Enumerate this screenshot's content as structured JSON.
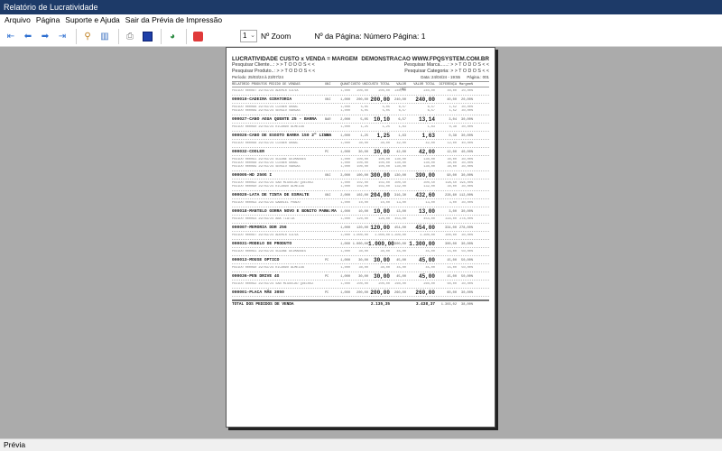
{
  "window": {
    "title": "Relatório de Lucratividade"
  },
  "menu": [
    "Arquivo",
    "Página",
    "Suporte e Ajuda",
    "Sair da Prévia de Impressão"
  ],
  "toolbar": {
    "page_select": "1",
    "zoom_label": "Nº Zoom",
    "page_info": "Nº da Página: Número Página: 1",
    "icons": [
      "first-page-icon",
      "previous-page-icon",
      "next-page-icon",
      "last-page-icon",
      "zoom-icon",
      "page-view-icon",
      "print-icon",
      "export-icon",
      "web-icon",
      "close-icon"
    ]
  },
  "status": "Prévia",
  "report": {
    "title": "LUCRATIVIDADE CUSTO x VENDA = MARGEM",
    "site": "DEMONSTRACAO WWW.FPQSYSTEM.COM.BR",
    "filter_cliente": "Pesquisar Cliente...: > > T O D O S < <",
    "filter_produto": "Pesquisar Produto..: > > T O D O S < <",
    "filter_marca": "Pesquisar Marca......: > > T O D O S < <",
    "filter_categoria": "Pesquisar Categoria: > > T O D O S < <",
    "periodo": "Período: 25/03/24 à 23/07/24",
    "data": "Data: 24/04/24 - 19:55",
    "pagina": "Página.: 001",
    "columns": [
      "RELATÓRIO PRODUTOS PEDIDO DE VENDAS",
      "UNI",
      "QUANT",
      "CUSTO UNI",
      "CUSTO TOTAL",
      "VALOR UNI",
      "VALOR TOTAL",
      "DIFERENÇA",
      "Margem%"
    ],
    "groups": [
      {
        "details": [
          [
            "PEDIDO 000087 29/03/24 ADEMIR SILVA",
            "",
            "1,000",
            "200,00",
            "200,00",
            "240,00",
            "240,00",
            "40,00",
            "20,00%"
          ]
        ],
        "product": [
          "000010-CADEIRA GIRATORIA",
          "UNI",
          "1,000",
          "200,00",
          "200,00",
          "240,00",
          "240,00",
          "40,00",
          "20,00%"
        ]
      },
      {
        "details": [
          [
            "PEDIDO 000088 29/03/24 CLEBER GRAAL",
            "",
            "1,000",
            "5,05",
            "5,05",
            "6,57",
            "6,57",
            "1,52",
            "30,00%"
          ],
          [
            "PEDIDO 000089 29/03/24 SERGIO VARGAS",
            "",
            "1,000",
            "5,05",
            "5,05",
            "6,57",
            "6,57",
            "1,52",
            "30,00%"
          ]
        ],
        "product": [
          "000027-CANO AGUA QUENTE 25 - BARRA",
          "BAR",
          "2,000",
          "5,05",
          "10,10",
          "6,57",
          "13,14",
          "3,04",
          "30,00%"
        ]
      },
      {
        "details": [
          [
            "PEDIDO 000090 29/03/24 RICARDO ALMEIDA",
            "",
            "1,000",
            "1,25",
            "1,25",
            "1,63",
            "1,63",
            "0,38",
            "30,00%"
          ]
        ],
        "product": [
          "000026-CANO DE ESGOTO BARRA 150 2\" LINHA",
          "MTR",
          "1,000",
          "1,25",
          "1,25",
          "1,63",
          "1,63",
          "0,38",
          "30,00%"
        ]
      },
      {
        "details": [
          [
            "PEDIDO 000088 29/03/24 CLEBER GRAAL",
            "",
            "1,000",
            "30,00",
            "30,00",
            "42,00",
            "42,00",
            "12,00",
            "40,00%"
          ]
        ],
        "product": [
          "000032-COOLER",
          "PC",
          "1,000",
          "30,00",
          "30,00",
          "42,00",
          "42,00",
          "12,00",
          "40,00%"
        ]
      },
      {
        "details": [
          [
            "PEDIDO 000091 29/03/24 SUZANE GUIMARAES",
            "",
            "1,000",
            "100,00",
            "100,00",
            "130,00",
            "130,00",
            "30,00",
            "30,00%"
          ],
          [
            "PEDIDO 000088 29/03/24 CLEBER GRAAL",
            "",
            "1,000",
            "100,00",
            "100,00",
            "130,00",
            "130,00",
            "30,00",
            "30,00%"
          ],
          [
            "PEDIDO 000089 29/03/24 SERGIO VARGAS",
            "",
            "1,000",
            "100,00",
            "100,00",
            "130,00",
            "130,00",
            "30,00",
            "30,00%"
          ]
        ],
        "product": [
          "000005-HD 250G   I",
          "UNI",
          "3,000",
          "100,00",
          "300,00",
          "130,00",
          "390,00",
          "90,00",
          "30,00%"
        ]
      },
      {
        "details": [
          [
            "PEDIDO 000092 29/03/24 SAN MIGUELAO QUEIROZ",
            "",
            "1,000",
            "102,00",
            "102,00",
            "300,50",
            "300,50",
            "198,50",
            "194,00%"
          ],
          [
            "PEDIDO 000090 29/03/24 RICARDO ALMEIDA",
            "",
            "1,000",
            "102,00",
            "102,00",
            "132,00",
            "132,00",
            "30,00",
            "30,00%"
          ]
        ],
        "product": [
          "000020-LATA DE TINTA DE ESMALTE",
          "UNI",
          "2,000",
          "102,00",
          "204,00",
          "316,30",
          "432,60",
          "228,60",
          "112,00%"
        ]
      },
      {
        "details": [
          [
            "PEDIDO 000093 29/03/24 GABRIEL PRADO",
            "",
            "1,000",
            "10,00",
            "10,00",
            "13,00",
            "13,00",
            "3,00",
            "30,00%"
          ]
        ],
        "product": [
          "000018-MANTELO GORRA NOVO E BONITO PARA MA",
          "UNI",
          "1,000",
          "10,00",
          "10,00",
          "13,00",
          "13,00",
          "3,00",
          "30,00%"
        ]
      },
      {
        "details": [
          [
            "PEDIDO 000094 29/03/24 ANA TIATIA",
            "",
            "1,000",
            "120,00",
            "120,00",
            "454,00",
            "454,00",
            "334,00",
            "278,00%"
          ]
        ],
        "product": [
          "000007-MEMORIA DDR 256",
          "",
          "1,000",
          "120,00",
          "120,00",
          "454,00",
          "454,00",
          "334,00",
          "278,00%"
        ]
      },
      {
        "details": [
          [
            "PEDIDO 000087 29/03/24 ADEMIR SILVA",
            "",
            "1,000",
            "1.000,00",
            "1.000,00",
            "1.300,00",
            "1.300,00",
            "300,00",
            "30,00%"
          ]
        ],
        "product": [
          "000031-MODELO DE PRODUTO",
          "",
          "1,000",
          "1.000,00",
          "1.000,00",
          "1.300,00",
          "1.300,00",
          "300,00",
          "30,00%"
        ]
      },
      {
        "details": [
          [
            "PEDIDO 000091 29/03/24 SUZANE GUIMARAES",
            "",
            "1,000",
            "30,00",
            "30,00",
            "45,00",
            "45,00",
            "15,00",
            "50,00%"
          ]
        ],
        "product": [
          "000013-MOUSE OPTICO",
          "PC",
          "1,000",
          "30,00",
          "30,00",
          "45,00",
          "45,00",
          "15,00",
          "50,00%"
        ]
      },
      {
        "details": [
          [
            "PEDIDO 000090 29/03/24 RICARDO ALMEIDA",
            "",
            "1,000",
            "30,00",
            "30,00",
            "45,00",
            "45,00",
            "15,00",
            "50,00%"
          ]
        ],
        "product": [
          "000036-PEN DRIVE 4G",
          "PC",
          "1,000",
          "30,00",
          "30,00",
          "45,00",
          "45,00",
          "15,00",
          "50,00%"
        ]
      },
      {
        "details": [
          [
            "PEDIDO 000092 29/03/24 SAN MIGUELAO QUEIROZ",
            "",
            "1,000",
            "200,00",
            "200,00",
            "260,00",
            "260,00",
            "60,00",
            "30,00%"
          ]
        ],
        "product": [
          "000001-PLACA MÃE 3050",
          "PC",
          "1,000",
          "200,00",
          "200,00",
          "260,00",
          "260,00",
          "60,00",
          "30,00%"
        ]
      }
    ],
    "total": [
      "TOTAL DOS PEDIDOS DE VENDA",
      "",
      "",
      "",
      "2.135,35",
      "",
      "3.438,37",
      "1.303,02",
      "38,00%"
    ]
  }
}
